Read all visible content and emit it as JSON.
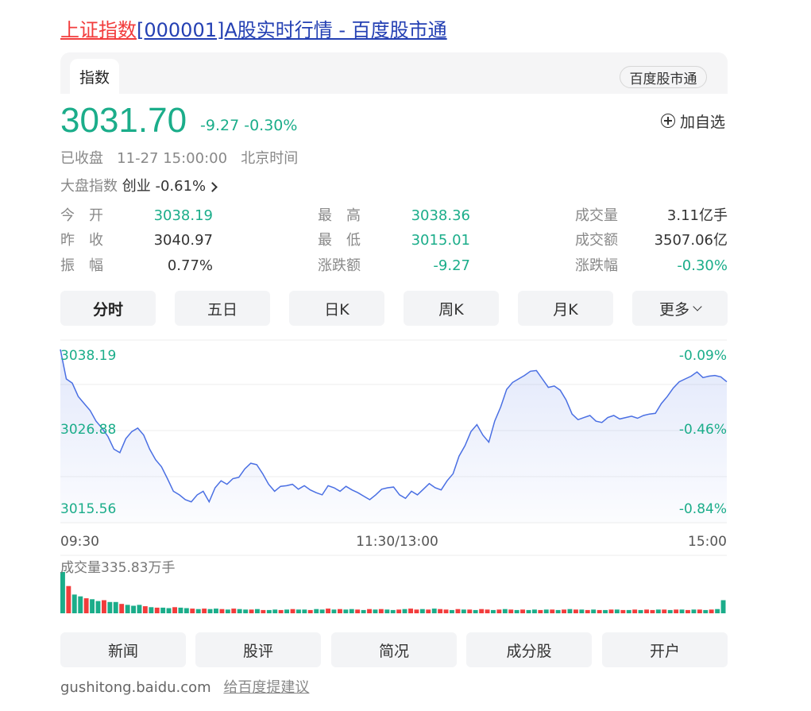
{
  "title": {
    "name_part": "上证指数",
    "rest_part": "[000001]A股实时行情 - 百度股市通"
  },
  "tabs": {
    "active": "指数",
    "badge": "百度股市通"
  },
  "quote": {
    "price": "3031.70",
    "change": "-9.27",
    "change_pct": "-0.30%",
    "add_watchlist": "加自选",
    "status": "已收盘",
    "time": "11-27 15:00:00",
    "timezone": "北京时间",
    "market_label": "大盘指数",
    "market_name": "创业",
    "market_change": "-0.61%"
  },
  "stats": {
    "col1": [
      {
        "label": "今　开",
        "value": "3038.19",
        "tone": "green"
      },
      {
        "label": "昨　收",
        "value": "3040.97",
        "tone": "dark"
      },
      {
        "label": "振　幅",
        "value": "0.77%",
        "tone": "dark"
      }
    ],
    "col2": [
      {
        "label": "最　高",
        "value": "3038.36",
        "tone": "green"
      },
      {
        "label": "最　低",
        "value": "3015.01",
        "tone": "green"
      },
      {
        "label": "涨跌额",
        "value": "-9.27",
        "tone": "green"
      }
    ],
    "col3": [
      {
        "label": "成交量",
        "value": "3.11亿手",
        "tone": "dark"
      },
      {
        "label": "成交额",
        "value": "3507.06亿",
        "tone": "dark"
      },
      {
        "label": "涨跌幅",
        "value": "-0.30%",
        "tone": "green"
      }
    ]
  },
  "periods": [
    "分时",
    "五日",
    "日K",
    "周K",
    "月K",
    "更多"
  ],
  "chart": {
    "y_left": [
      "3038.19",
      "3026.88",
      "3015.56"
    ],
    "y_right": [
      "-0.09%",
      "-0.46%",
      "-0.84%"
    ],
    "x_labels": [
      "09:30",
      "11:30/13:00",
      "15:00"
    ],
    "volume_label": "成交量335.83万手",
    "colors": {
      "line": "#4a6fe3",
      "ref": "#f07a2a",
      "up": "#f23c3c",
      "down": "#1bad8a"
    }
  },
  "chart_data": {
    "type": "line",
    "prev_close": 3040.97,
    "ylim": [
      3015.56,
      3038.19
    ],
    "x_range": [
      "09:30",
      "15:00"
    ],
    "price": [
      3038.2,
      3034,
      3033.4,
      3031.5,
      3030.5,
      3029.5,
      3028,
      3027,
      3025.8,
      3024,
      3023.5,
      3025.5,
      3026.5,
      3027,
      3026,
      3024,
      3022.5,
      3021.5,
      3019.8,
      3018,
      3017.5,
      3016.8,
      3016.5,
      3017.5,
      3018,
      3016.5,
      3018.5,
      3019.5,
      3019,
      3019.8,
      3020,
      3021.2,
      3022,
      3021.8,
      3020.5,
      3019,
      3018,
      3018.7,
      3018.8,
      3019,
      3018.3,
      3018.8,
      3018.2,
      3017.8,
      3017.5,
      3018.8,
      3018.5,
      3018,
      3018.7,
      3018.2,
      3017.8,
      3017.3,
      3016.8,
      3017.5,
      3018.3,
      3018.5,
      3018.6,
      3017.5,
      3017,
      3018,
      3017.5,
      3018.3,
      3019.1,
      3018.5,
      3018.2,
      3019.5,
      3020.5,
      3023,
      3024.5,
      3026.5,
      3027.5,
      3026,
      3025,
      3028,
      3030,
      3032.5,
      3033.5,
      3034,
      3034.5,
      3035.1,
      3035.2,
      3034,
      3032.8,
      3033,
      3032.4,
      3031,
      3029,
      3028.2,
      3028.5,
      3028.8,
      3028,
      3027.8,
      3028.5,
      3028.8,
      3028.3,
      3028.5,
      3028.7,
      3028.4,
      3028.8,
      3029,
      3029.1,
      3030.5,
      3031.5,
      3032.7,
      3033.6,
      3034,
      3034.4,
      3035,
      3034.2,
      3034.4,
      3034.5,
      3034.3,
      3033.6
    ],
    "volume": [
      88,
      58,
      40,
      36,
      32,
      30,
      26,
      28,
      24,
      24,
      20,
      18,
      16,
      18,
      15,
      13,
      12,
      12,
      11,
      13,
      12,
      11,
      10,
      9,
      10,
      9,
      10,
      9,
      8,
      10,
      9,
      8,
      8,
      9,
      7,
      7,
      8,
      7,
      8,
      9,
      8,
      8,
      7,
      9,
      8,
      10,
      8,
      9,
      8,
      9,
      8,
      7,
      9,
      8,
      9,
      8,
      7,
      8,
      9,
      10,
      8,
      9,
      8,
      10,
      9,
      8,
      7,
      9,
      8,
      8,
      7,
      9,
      8,
      7,
      8,
      9,
      8,
      7,
      8,
      7,
      8,
      7,
      8,
      8,
      7,
      8,
      9,
      8,
      8,
      7,
      8,
      7,
      7,
      8,
      8,
      7,
      7,
      8,
      7,
      8,
      7,
      8,
      8,
      7,
      8,
      8,
      7,
      8,
      8,
      7,
      8,
      9,
      28
    ],
    "volume_up": [
      false,
      true,
      false,
      false,
      true,
      false,
      false,
      true,
      false,
      false,
      true,
      false,
      false,
      false,
      true,
      false,
      true,
      false,
      false,
      true,
      false,
      false,
      true,
      false,
      true,
      false,
      false,
      true,
      false,
      true,
      false,
      false,
      true,
      false,
      true,
      false,
      false,
      true,
      false,
      true,
      false,
      false,
      true,
      false,
      false,
      true,
      false,
      true,
      false,
      false,
      true,
      false,
      true,
      false,
      true,
      false,
      false,
      true,
      false,
      true,
      true,
      false,
      true,
      false,
      true,
      true,
      false,
      true,
      false,
      true,
      false,
      true,
      true,
      false,
      true,
      false,
      true,
      false,
      true,
      false,
      false,
      true,
      false,
      true,
      false,
      true,
      false,
      true,
      false,
      true,
      false,
      true,
      false,
      true,
      false,
      true,
      false,
      true,
      false,
      true,
      true,
      false,
      true,
      false,
      true,
      false,
      true,
      false,
      true,
      false,
      true,
      false,
      false
    ]
  },
  "bottom_tabs": [
    "新闻",
    "股评",
    "简况",
    "成分股",
    "开户"
  ],
  "footer": {
    "domain": "gushitong.baidu.com",
    "suggest": "给百度提建议"
  }
}
